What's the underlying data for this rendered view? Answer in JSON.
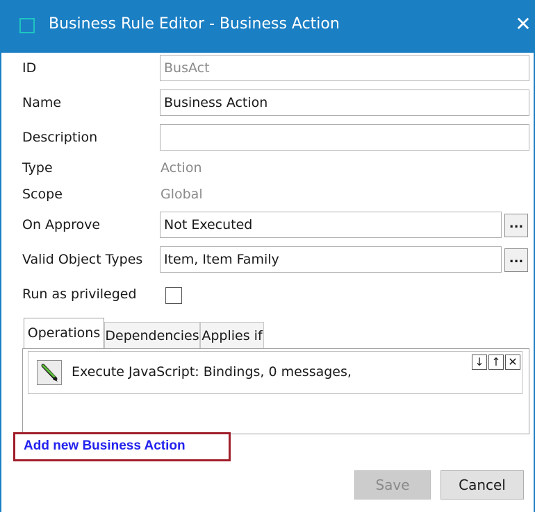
{
  "window": {
    "title": "Business Rule Editor - Business Action",
    "close_glyph": "✕"
  },
  "form": {
    "id": {
      "label": "ID",
      "value": "BusAct"
    },
    "name": {
      "label": "Name",
      "value": "Business Action"
    },
    "description": {
      "label": "Description",
      "value": ""
    },
    "type": {
      "label": "Type",
      "value": "Action"
    },
    "scope": {
      "label": "Scope",
      "value": "Global"
    },
    "on_approve": {
      "label": "On Approve",
      "value": "Not Executed",
      "browse_label": "..."
    },
    "valid_object_types": {
      "label": "Valid Object Types",
      "value": "Item, Item Family",
      "browse_label": "..."
    },
    "run_as_privileged": {
      "label": "Run as privileged",
      "checked": false
    }
  },
  "tabs": [
    {
      "label": "Operations",
      "active": true
    },
    {
      "label": "Dependencies",
      "active": false
    },
    {
      "label": "Applies if",
      "active": false
    }
  ],
  "operations": [
    {
      "text": "Execute JavaScript: Bindings, 0 messages,"
    }
  ],
  "row_controls": {
    "down": "↓",
    "up": "↑",
    "remove": "✕"
  },
  "add_link": "Add new Business Action",
  "buttons": {
    "save": "Save",
    "cancel": "Cancel"
  },
  "colors": {
    "titlebar": "#1b7fc4",
    "link": "#2222ee",
    "highlight_box": "#a01e2a"
  }
}
